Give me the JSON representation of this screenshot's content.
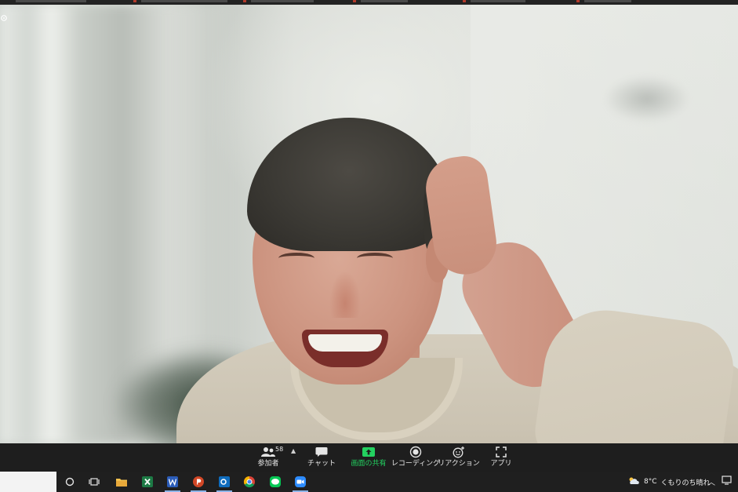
{
  "toolbar": {
    "participants_count": "58",
    "participants_label": "参加者",
    "chat_label": "チャット",
    "share_label": "画面の共有",
    "record_label": "レコーディング",
    "reaction_label": "リアクション",
    "apps_label": "アプリ"
  },
  "taskbar": {
    "weather_temp": "8°C",
    "weather_text": "くもりのち晴れ",
    "pinned_apps": [
      "explorer",
      "excel",
      "word",
      "powerpoint",
      "outlook",
      "chrome",
      "line",
      "zoom"
    ]
  },
  "colors": {
    "share_accent": "#23d160",
    "toolbar_bg": "#1e1e1e",
    "taskbar_bg": "#1f1f1f"
  }
}
